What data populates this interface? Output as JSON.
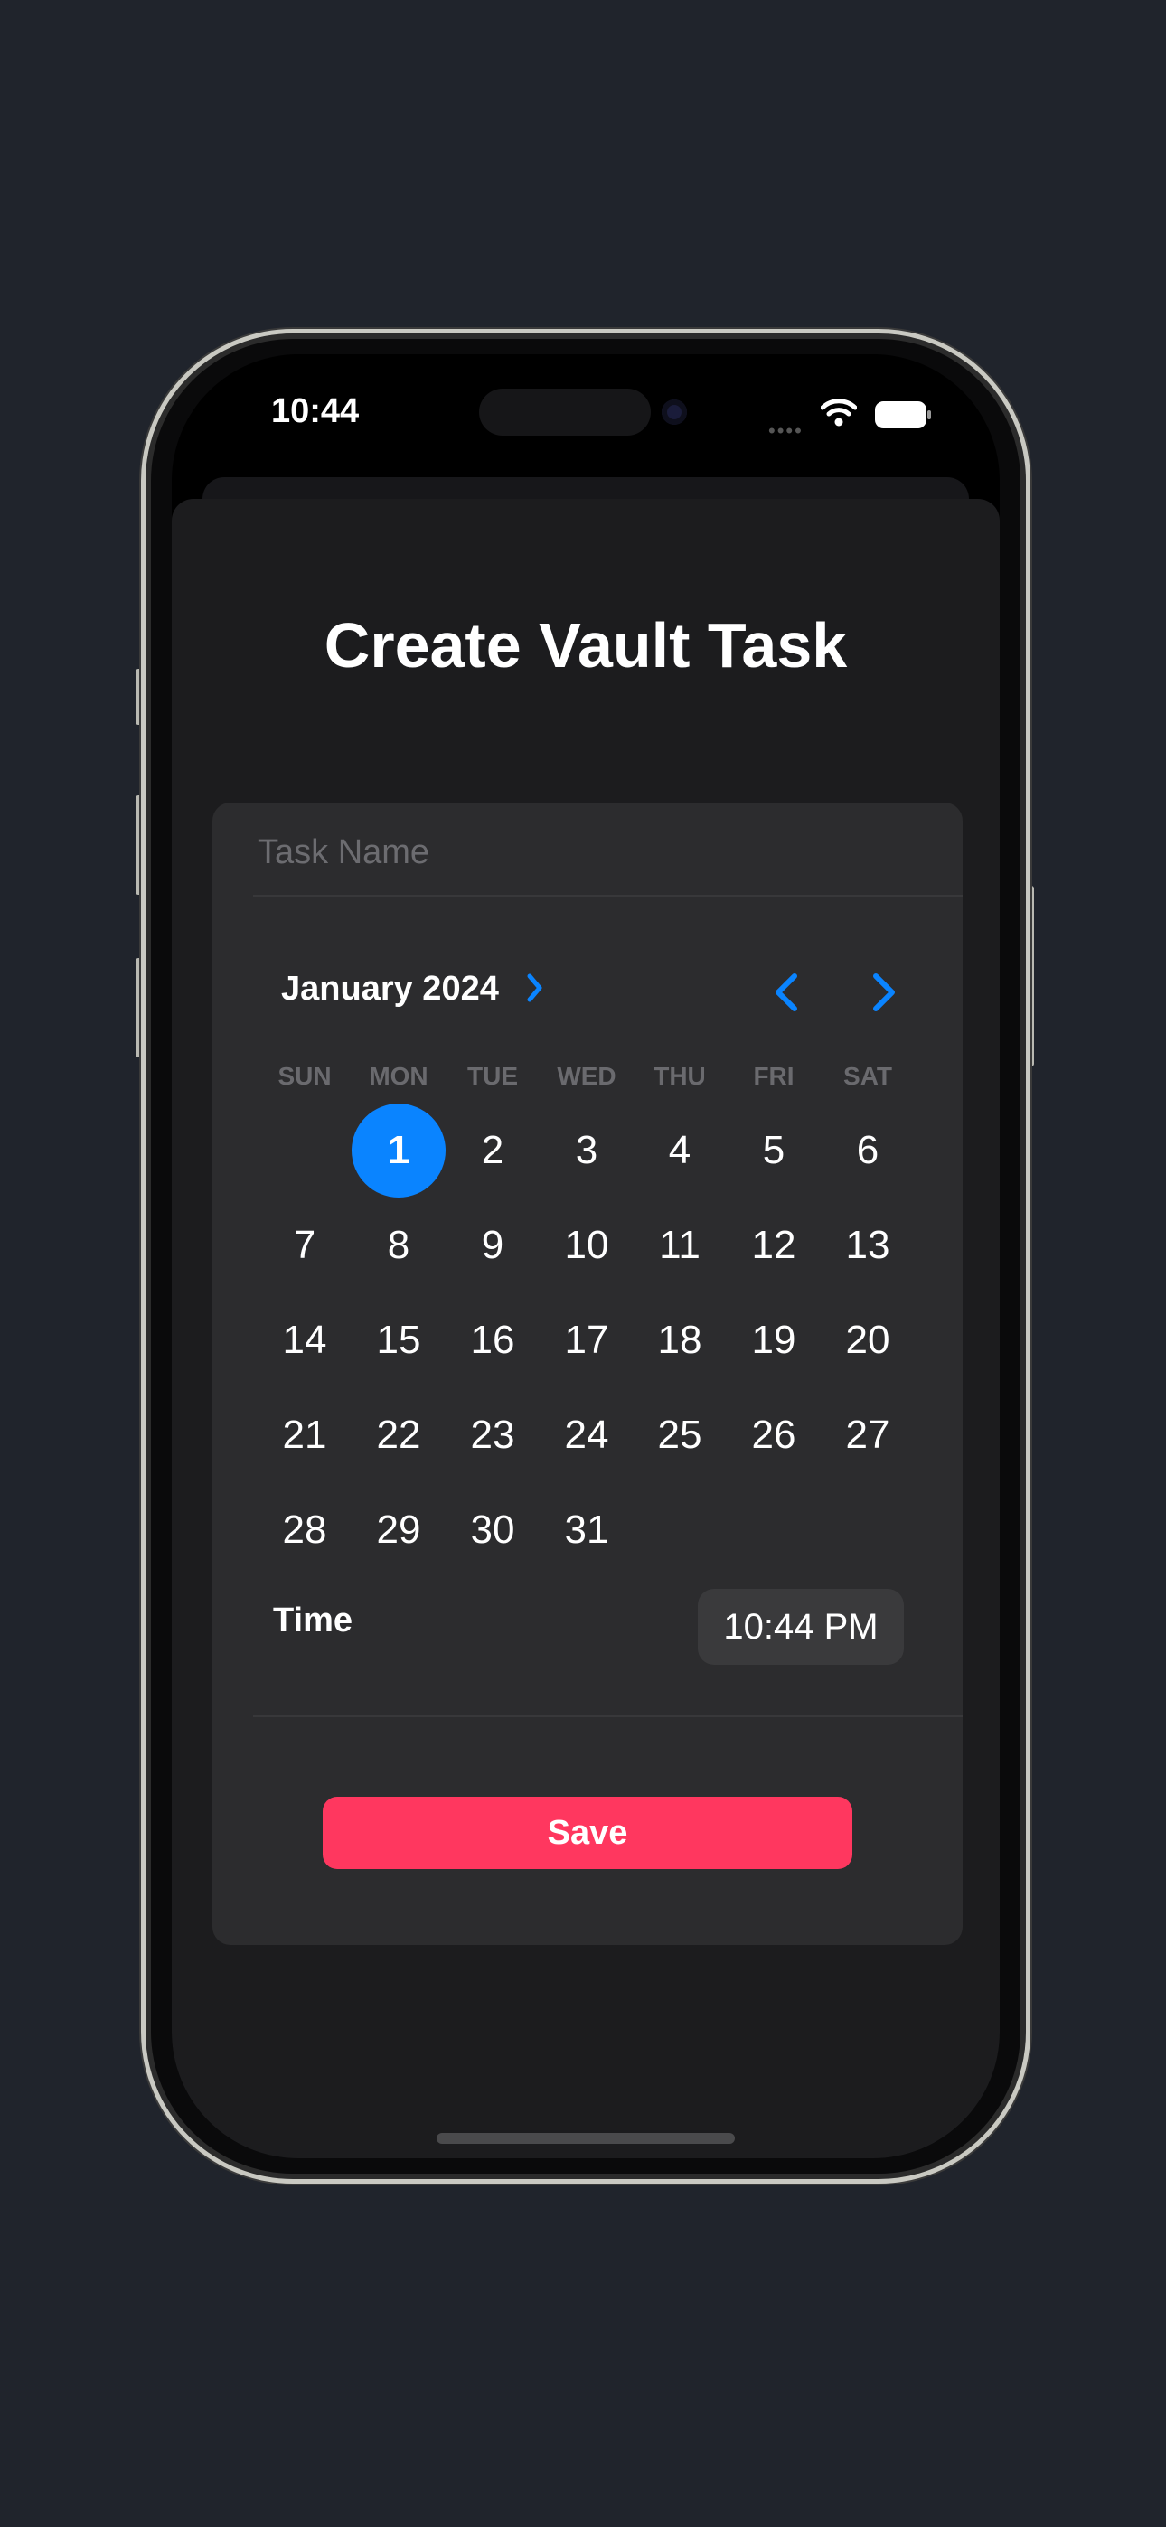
{
  "status_bar": {
    "time": "10:44"
  },
  "sheet": {
    "title": "Create Vault Task",
    "task_name_placeholder": "Task Name",
    "task_name_value": ""
  },
  "calendar": {
    "month_label": "January 2024",
    "weekdays": [
      "SUN",
      "MON",
      "TUE",
      "WED",
      "THU",
      "FRI",
      "SAT"
    ],
    "first_weekday_index": 1,
    "days_in_month": 31,
    "selected_day": 1
  },
  "time_row": {
    "label": "Time",
    "value": "10:44 PM"
  },
  "save_button": {
    "label": "Save"
  },
  "colors": {
    "accent": "#0a84ff",
    "save": "#ff375f",
    "card": "#2c2c2e",
    "sheet": "#1c1c1e"
  }
}
